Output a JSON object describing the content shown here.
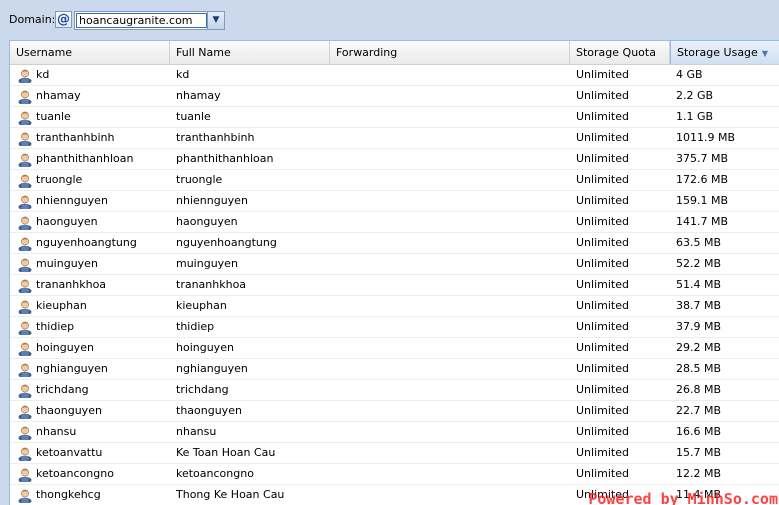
{
  "toolbar": {
    "domain_label": "Domain:",
    "domain_icon_glyph": "@",
    "domain_value": "hoancaugranite.com",
    "dropdown_glyph": "▼"
  },
  "grid": {
    "columns": [
      {
        "key": "username",
        "label": "Username"
      },
      {
        "key": "full_name",
        "label": "Full Name"
      },
      {
        "key": "forwarding",
        "label": "Forwarding"
      },
      {
        "key": "storage_quota",
        "label": "Storage Quota"
      },
      {
        "key": "storage_usage",
        "label": "Storage Usage",
        "sorted": "descending"
      }
    ],
    "sort_glyph": "▼",
    "rows": [
      {
        "username": "kd",
        "full_name": "kd",
        "forwarding": "",
        "storage_quota": "Unlimited",
        "storage_usage": "4 GB"
      },
      {
        "username": "nhamay",
        "full_name": "nhamay",
        "forwarding": "",
        "storage_quota": "Unlimited",
        "storage_usage": "2.2 GB"
      },
      {
        "username": "tuanle",
        "full_name": "tuanle",
        "forwarding": "",
        "storage_quota": "Unlimited",
        "storage_usage": "1.1 GB"
      },
      {
        "username": "tranthanhbinh",
        "full_name": "tranthanhbinh",
        "forwarding": "",
        "storage_quota": "Unlimited",
        "storage_usage": "1011.9 MB"
      },
      {
        "username": "phanthithanhloan",
        "full_name": "phanthithanhloan",
        "forwarding": "",
        "storage_quota": "Unlimited",
        "storage_usage": "375.7 MB"
      },
      {
        "username": "truongle",
        "full_name": "truongle",
        "forwarding": "",
        "storage_quota": "Unlimited",
        "storage_usage": "172.6 MB"
      },
      {
        "username": "nhiennguyen",
        "full_name": "nhiennguyen",
        "forwarding": "",
        "storage_quota": "Unlimited",
        "storage_usage": "159.1 MB"
      },
      {
        "username": "haonguyen",
        "full_name": "haonguyen",
        "forwarding": "",
        "storage_quota": "Unlimited",
        "storage_usage": "141.7 MB"
      },
      {
        "username": "nguyenhoangtung",
        "full_name": "nguyenhoangtung",
        "forwarding": "",
        "storage_quota": "Unlimited",
        "storage_usage": "63.5 MB"
      },
      {
        "username": "muinguyen",
        "full_name": "muinguyen",
        "forwarding": "",
        "storage_quota": "Unlimited",
        "storage_usage": "52.2 MB"
      },
      {
        "username": "trananhkhoa",
        "full_name": "trananhkhoa",
        "forwarding": "",
        "storage_quota": "Unlimited",
        "storage_usage": "51.4 MB"
      },
      {
        "username": "kieuphan",
        "full_name": "kieuphan",
        "forwarding": "",
        "storage_quota": "Unlimited",
        "storage_usage": "38.7 MB"
      },
      {
        "username": "thidiep",
        "full_name": "thidiep",
        "forwarding": "",
        "storage_quota": "Unlimited",
        "storage_usage": "37.9 MB"
      },
      {
        "username": "hoinguyen",
        "full_name": "hoinguyen",
        "forwarding": "",
        "storage_quota": "Unlimited",
        "storage_usage": "29.2 MB"
      },
      {
        "username": "nghianguyen",
        "full_name": "nghianguyen",
        "forwarding": "",
        "storage_quota": "Unlimited",
        "storage_usage": "28.5 MB"
      },
      {
        "username": "trichdang",
        "full_name": "trichdang",
        "forwarding": "",
        "storage_quota": "Unlimited",
        "storage_usage": "26.8 MB"
      },
      {
        "username": "thaonguyen",
        "full_name": "thaonguyen",
        "forwarding": "",
        "storage_quota": "Unlimited",
        "storage_usage": "22.7 MB"
      },
      {
        "username": "nhansu",
        "full_name": "nhansu",
        "forwarding": "",
        "storage_quota": "Unlimited",
        "storage_usage": "16.6 MB"
      },
      {
        "username": "ketoanvattu",
        "full_name": "Ke Toan Hoan Cau",
        "forwarding": "",
        "storage_quota": "Unlimited",
        "storage_usage": "15.7 MB"
      },
      {
        "username": "ketoancongno",
        "full_name": "ketoancongno",
        "forwarding": "",
        "storage_quota": "Unlimited",
        "storage_usage": "12.2 MB"
      },
      {
        "username": "thongkehcg",
        "full_name": "Thong Ke Hoan Cau",
        "forwarding": "",
        "storage_quota": "Unlimited",
        "storage_usage": "11.4 MB"
      }
    ]
  },
  "watermark": "Powered by MinhSo.com",
  "colors": {
    "toolbar_bg": "#ccd9ec",
    "sorted_header_bg": "#cfdff2",
    "watermark": "#ff2020"
  },
  "icons": {
    "domain": "at-sign-icon",
    "row": "user-icon",
    "dropdown": "chevron-down-icon",
    "sort": "sort-descending-icon"
  }
}
